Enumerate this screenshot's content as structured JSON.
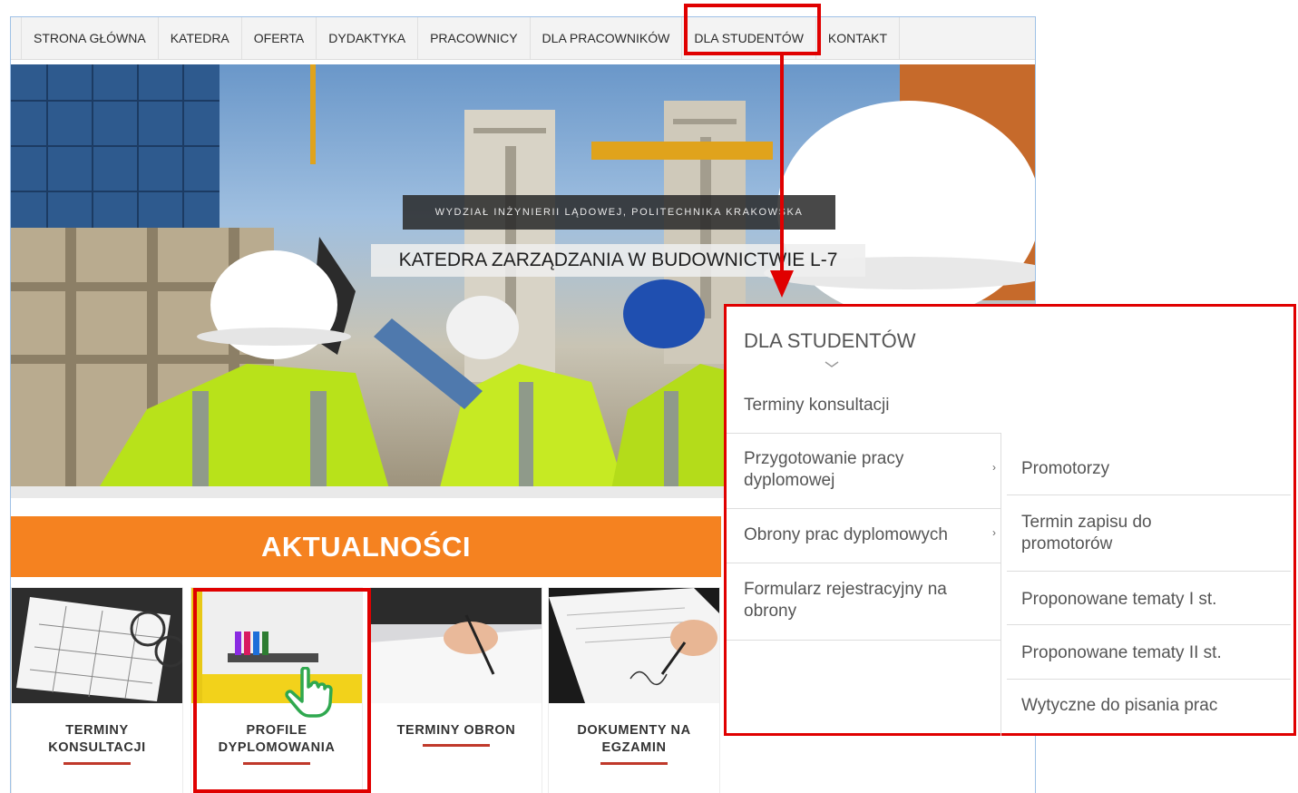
{
  "nav": {
    "items": [
      {
        "label": "STRONA GŁÓWNA"
      },
      {
        "label": "KATEDRA"
      },
      {
        "label": "OFERTA"
      },
      {
        "label": "DYDAKTYKA"
      },
      {
        "label": "PRACOWNICY"
      },
      {
        "label": "DLA PRACOWNIKÓW"
      },
      {
        "label": "DLA STUDENTÓW"
      },
      {
        "label": "KONTAKT"
      }
    ]
  },
  "hero": {
    "subtitle": "WYDZIAŁ INŻYNIERII LĄDOWEJ, POLITECHNIKA KRAKOWSKA",
    "title": "KATEDRA ZARZĄDZANIA W BUDOWNICTWIE L-7"
  },
  "news": {
    "header": "AKTUALNOŚCI",
    "cards": [
      {
        "line1": "TERMINY",
        "line2": "KONSULTACJI"
      },
      {
        "line1": "PROFILE",
        "line2": "DYPLOMOWANIA"
      },
      {
        "line1": "TERMINY OBRON",
        "line2": ""
      },
      {
        "line1": "DOKUMENTY NA",
        "line2": "EGZAMIN"
      }
    ]
  },
  "dropdown": {
    "title": "DLA STUDENTÓW",
    "items": [
      {
        "line1": "Terminy konsultacji",
        "line2": ""
      },
      {
        "line1": "Przygotowanie pracy",
        "line2": "dyplomowej"
      },
      {
        "line1": "Obrony prac dyplomowych",
        "line2": ""
      },
      {
        "line1": "Formularz rejestracyjny na",
        "line2": "obrony"
      }
    ],
    "submenu": [
      {
        "line1": "Promotorzy",
        "line2": ""
      },
      {
        "line1": "Termin zapisu do",
        "line2": "promotorów"
      },
      {
        "line1": "Proponowane tematy I st.",
        "line2": ""
      },
      {
        "line1": "Proponowane tematy II st.",
        "line2": ""
      },
      {
        "line1": "Wytyczne do pisania prac",
        "line2": ""
      }
    ],
    "arrow_glyph": "›"
  },
  "colors": {
    "accent_orange": "#f58220",
    "highlight_red": "#e00000",
    "underline_red": "#c0392b",
    "cursor_green": "#2fa84f"
  }
}
